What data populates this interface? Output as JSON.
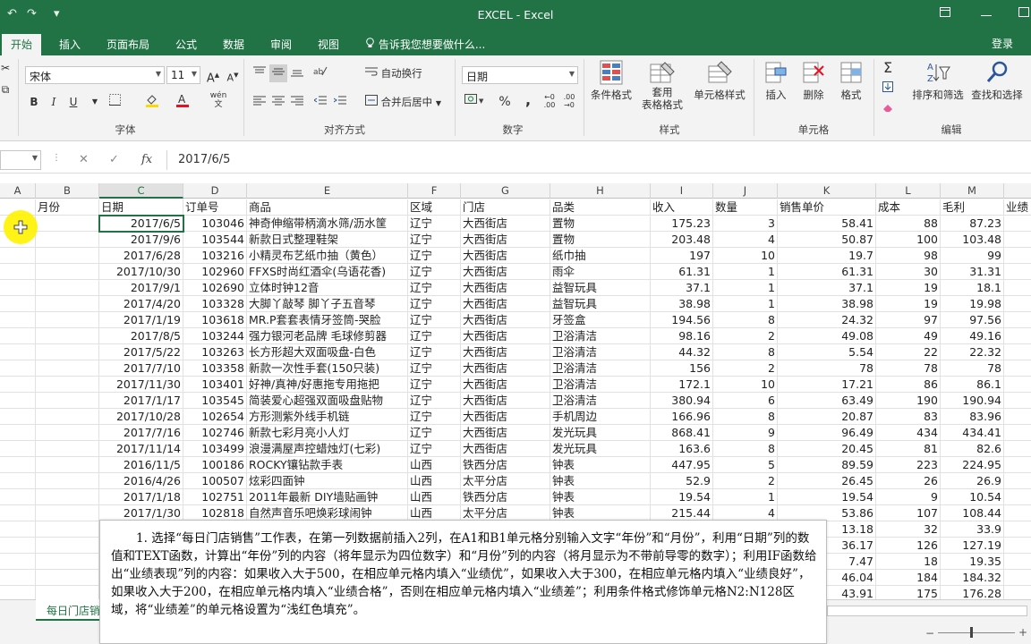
{
  "window": {
    "title": "EXCEL - Excel",
    "quick_access": [
      "↶",
      "↷",
      "▾"
    ]
  },
  "menu": {
    "tabs": [
      "开始",
      "插入",
      "页面布局",
      "公式",
      "数据",
      "审阅",
      "视图"
    ],
    "tellme": "告诉我您想要做什么...",
    "signin": "登录"
  },
  "ribbon": {
    "font_name": "宋体",
    "font_size": "11",
    "wrap_text": "自动换行",
    "merge_center": "合并后居中",
    "number_format": "日期",
    "cond_format": "条件格式",
    "table_format_1": "套用",
    "table_format_2": "表格格式",
    "cell_style": "单元格样式",
    "insert": "插入",
    "delete": "删除",
    "format": "格式",
    "sort_filter": "排序和筛选",
    "find_select": "查找和选择",
    "groups": {
      "font": "字体",
      "alignment": "对齐方式",
      "number": "数字",
      "styles": "样式",
      "cells": "单元格",
      "editing": "编辑"
    },
    "bold": "B",
    "italic": "I",
    "underline": "U",
    "percent": "%",
    "comma": ",",
    "wen": "wén"
  },
  "formula_bar": {
    "value": "2017/6/5",
    "fx": "fx"
  },
  "columns": [
    "A",
    "B",
    "C",
    "D",
    "E",
    "F",
    "G",
    "H",
    "I",
    "J",
    "K",
    "L",
    "M"
  ],
  "headers": [
    "",
    "月份",
    "日期",
    "订单号",
    "商品",
    "区域",
    "门店",
    "品类",
    "收入",
    "数量",
    "销售单价",
    "成本",
    "毛利",
    "业绩"
  ],
  "rows": [
    [
      "2017/6/5",
      "103046",
      "神奇伸缩带柄滴水筛/沥水筐",
      "辽宁",
      "大西街店",
      "置物",
      "175.23",
      "3",
      "58.41",
      "88",
      "87.23"
    ],
    [
      "2017/9/6",
      "103544",
      "新款日式整理鞋架",
      "辽宁",
      "大西街店",
      "置物",
      "203.48",
      "4",
      "50.87",
      "100",
      "103.48"
    ],
    [
      "2017/6/28",
      "103216",
      "小精灵布艺纸巾抽（黄色）",
      "辽宁",
      "大西街店",
      "纸巾抽",
      "197",
      "10",
      "19.7",
      "98",
      "99"
    ],
    [
      "2017/10/30",
      "102960",
      "FFXS时尚红酒伞(乌语花香)",
      "辽宁",
      "大西街店",
      "雨伞",
      "61.31",
      "1",
      "61.31",
      "30",
      "31.31"
    ],
    [
      "2017/9/1",
      "102690",
      "立体时钟12音",
      "辽宁",
      "大西街店",
      "益智玩具",
      "37.1",
      "1",
      "37.1",
      "19",
      "18.1"
    ],
    [
      "2017/4/20",
      "103328",
      "大脚丫敲琴 脚丫子五音琴",
      "辽宁",
      "大西街店",
      "益智玩具",
      "38.98",
      "1",
      "38.98",
      "19",
      "19.98"
    ],
    [
      "2017/1/19",
      "103618",
      "MR.P套套表情牙签筒-哭脸",
      "辽宁",
      "大西街店",
      "牙签盒",
      "194.56",
      "8",
      "24.32",
      "97",
      "97.56"
    ],
    [
      "2017/8/5",
      "103244",
      "强力银河老品牌 毛球修剪器",
      "辽宁",
      "大西街店",
      "卫浴清洁",
      "98.16",
      "2",
      "49.08",
      "49",
      "49.16"
    ],
    [
      "2017/5/22",
      "103263",
      "长方形超大双面吸盘-白色",
      "辽宁",
      "大西街店",
      "卫浴清洁",
      "44.32",
      "8",
      "5.54",
      "22",
      "22.32"
    ],
    [
      "2017/7/10",
      "103358",
      "新款一次性手套(150只装)",
      "辽宁",
      "大西街店",
      "卫浴清洁",
      "156",
      "2",
      "78",
      "78",
      "78"
    ],
    [
      "2017/11/30",
      "103401",
      "好神/真神/好惠拖专用拖把",
      "辽宁",
      "大西街店",
      "卫浴清洁",
      "172.1",
      "10",
      "17.21",
      "86",
      "86.1"
    ],
    [
      "2017/1/17",
      "103545",
      "简装爱心超强双面吸盘贴物",
      "辽宁",
      "大西街店",
      "卫浴清洁",
      "380.94",
      "6",
      "63.49",
      "190",
      "190.94"
    ],
    [
      "2017/10/28",
      "102654",
      "方形测紫外线手机链",
      "辽宁",
      "大西街店",
      "手机周边",
      "166.96",
      "8",
      "20.87",
      "83",
      "83.96"
    ],
    [
      "2017/7/16",
      "102746",
      "新款七彩月亮小人灯",
      "辽宁",
      "大西街店",
      "发光玩具",
      "868.41",
      "9",
      "96.49",
      "434",
      "434.41"
    ],
    [
      "2017/11/14",
      "103499",
      "浪漫满屋声控蜡烛灯(七彩)",
      "辽宁",
      "大西街店",
      "发光玩具",
      "163.6",
      "8",
      "20.45",
      "81",
      "82.6"
    ],
    [
      "2016/11/5",
      "100186",
      "ROCKY镶钻款手表",
      "山西",
      "铁西分店",
      "钟表",
      "447.95",
      "5",
      "89.59",
      "223",
      "224.95"
    ],
    [
      "2016/4/26",
      "100507",
      "炫彩四面钟",
      "山西",
      "太平分店",
      "钟表",
      "52.9",
      "2",
      "26.45",
      "26",
      "26.9"
    ],
    [
      "2017/1/18",
      "102751",
      "2011年最新 DIY墙贴画钟",
      "山西",
      "铁西分店",
      "钟表",
      "19.54",
      "1",
      "19.54",
      "9",
      "10.54"
    ],
    [
      "2017/1/30",
      "102818",
      "自然声音乐吧焕彩球闹钟",
      "山西",
      "太平分店",
      "钟表",
      "215.44",
      "4",
      "53.86",
      "107",
      "108.44"
    ],
    [
      "",
      "",
      "",
      "",
      "",
      "",
      "",
      "",
      "13.18",
      "32",
      "33.9"
    ],
    [
      "",
      "",
      "",
      "",
      "",
      "",
      "",
      "",
      "36.17",
      "126",
      "127.19"
    ],
    [
      "",
      "",
      "",
      "",
      "",
      "",
      "",
      "",
      "7.47",
      "18",
      "19.35"
    ],
    [
      "",
      "",
      "",
      "",
      "",
      "",
      "",
      "",
      "46.04",
      "184",
      "184.32"
    ],
    [
      "",
      "",
      "",
      "",
      "",
      "",
      "",
      "",
      "43.91",
      "175",
      "176.28"
    ]
  ],
  "sheet": {
    "tab": "每日门店销售"
  },
  "instructions": "1. 选择“每日门店销售”工作表，在第一列数据前插入2列，在A1和B1单元格分别输入文字“年份”和“月份”，利用“日期”列的数值和TEXT函数，计算出“年份”列的内容（将年显示为四位数字）和“月份”列的内容（将月显示为不带前导零的数字）；利用IF函数给出“业绩表现”列的内容：如果收入大于500，在相应单元格内填入“业绩优”，如果收入大于300，在相应单元格内填入“业绩良好”，如果收入大于200，在相应单元格内填入“业绩合格”，否则在相应单元格内填入“业绩差”；利用条件格式修饰单元格N2:N128区域，将“业绩差”的单元格设置为“浅红色填充”。",
  "colors": {
    "accent": "#217346",
    "cursor": "#fff200"
  }
}
